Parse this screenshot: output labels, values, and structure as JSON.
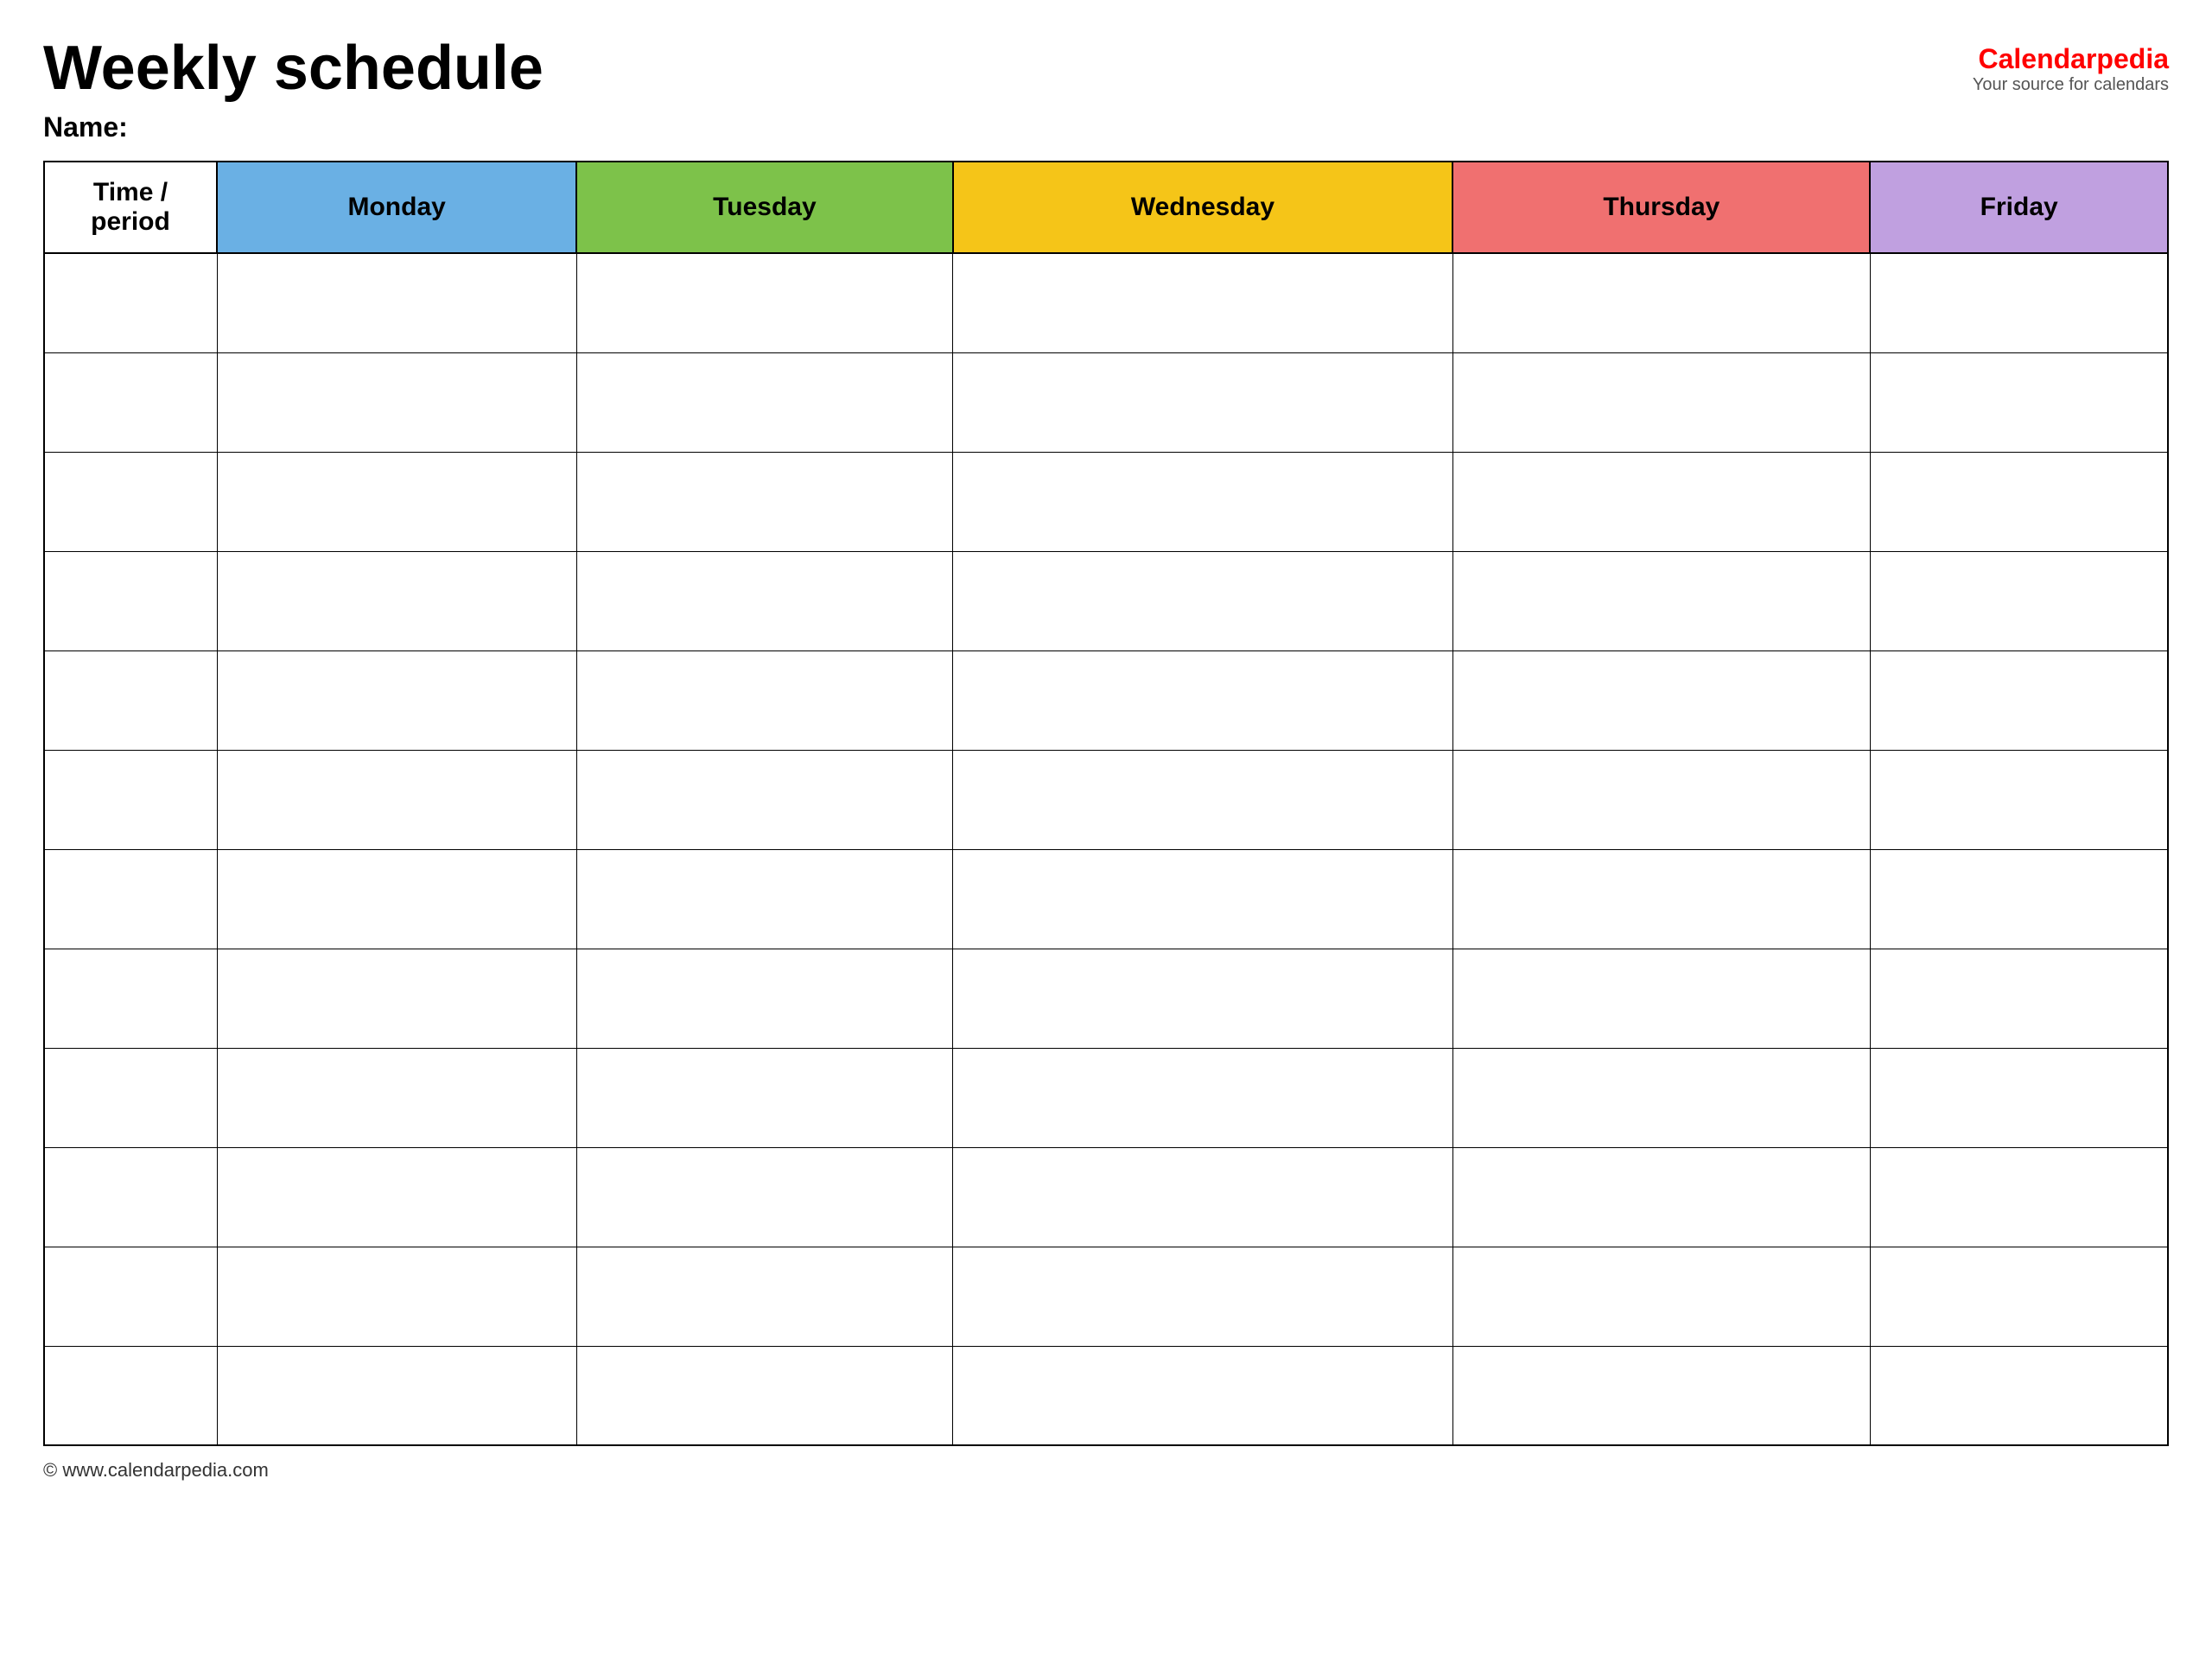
{
  "header": {
    "title": "Weekly schedule",
    "logo": {
      "brand_plain": "Calendar",
      "brand_accent": "pedia",
      "tagline": "Your source for calendars"
    }
  },
  "name_label": "Name:",
  "table": {
    "columns": [
      {
        "key": "time",
        "label": "Time / period",
        "color": "#ffffff"
      },
      {
        "key": "monday",
        "label": "Monday",
        "color": "#6ab0e4"
      },
      {
        "key": "tuesday",
        "label": "Tuesday",
        "color": "#7dc24a"
      },
      {
        "key": "wednesday",
        "label": "Wednesday",
        "color": "#f5c518"
      },
      {
        "key": "thursday",
        "label": "Thursday",
        "color": "#f07070"
      },
      {
        "key": "friday",
        "label": "Friday",
        "color": "#c0a0e0"
      }
    ],
    "row_count": 12
  },
  "footer": {
    "url": "© www.calendarpedia.com"
  }
}
